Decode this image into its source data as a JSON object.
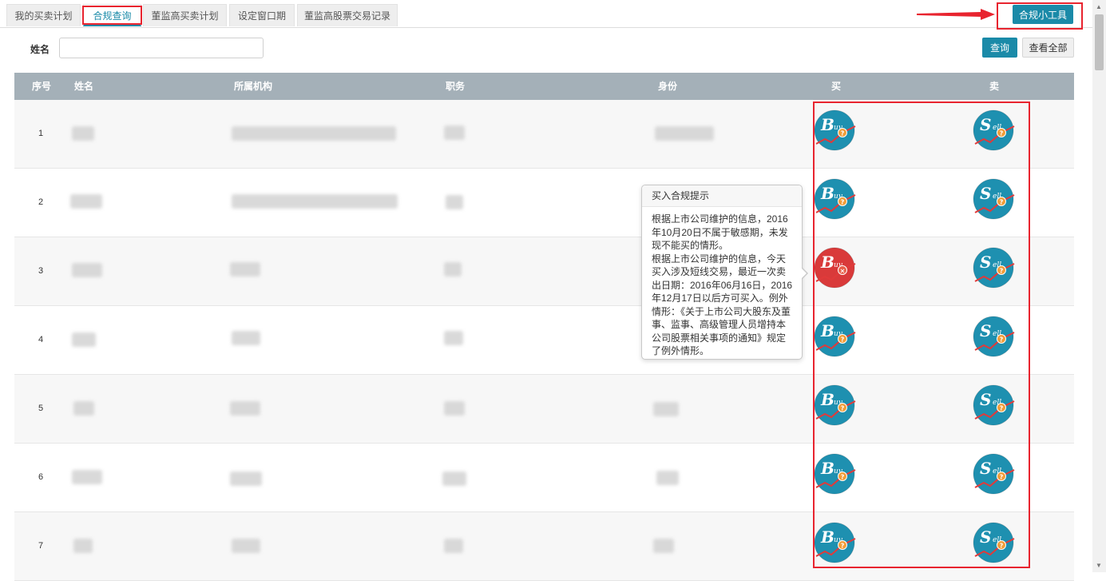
{
  "tabs": [
    {
      "label": "我的买卖计划"
    },
    {
      "label": "合规查询"
    },
    {
      "label": "董监高买卖计划"
    },
    {
      "label": "设定窗口期"
    },
    {
      "label": "董监高股票交易记录"
    }
  ],
  "toolbar": {
    "tool_label": "合规小工具"
  },
  "search": {
    "label": "姓名",
    "value": "",
    "placeholder": "",
    "query_label": "查询",
    "show_all_label": "查看全部"
  },
  "table": {
    "headers": {
      "index": "序号",
      "name": "姓名",
      "org": "所属机构",
      "position": "职务",
      "identity": "身份",
      "buy": "买",
      "sell": "卖"
    },
    "rows": [
      {
        "index": "1",
        "buy_status": "ok"
      },
      {
        "index": "2",
        "buy_status": "ok"
      },
      {
        "index": "3",
        "buy_status": "forbidden"
      },
      {
        "index": "4",
        "buy_status": "ok"
      },
      {
        "index": "5",
        "buy_status": "ok"
      },
      {
        "index": "6",
        "buy_status": "ok"
      },
      {
        "index": "7",
        "buy_status": "ok"
      }
    ]
  },
  "tooltip": {
    "title": "买入合规提示",
    "paragraph1": "根据上市公司维护的信息，2016年10月20日不属于敏感期，未发现不能买的情形。",
    "paragraph2": "根据上市公司维护的信息，今天买入涉及短线交易，最近一次卖出日期：2016年06月16日，2016年12月17日以后方可买入。例外情形：《关于上市公司大股东及董事、监事、高级管理人员增持本公司股票相关事项的通知》规定了例外情形。"
  },
  "colors": {
    "accent": "#1a8aa8",
    "header_bg": "#a4b0b8",
    "highlight": "#e8242f",
    "icon_blue": "#1e90b0",
    "icon_red": "#d93a3a",
    "badge_orange": "#f29d38"
  },
  "icons": {
    "buy": "buy-letter-B-icon",
    "sell": "sell-letter-S-icon",
    "help": "question-badge-icon",
    "forbidden": "x-badge-icon"
  }
}
